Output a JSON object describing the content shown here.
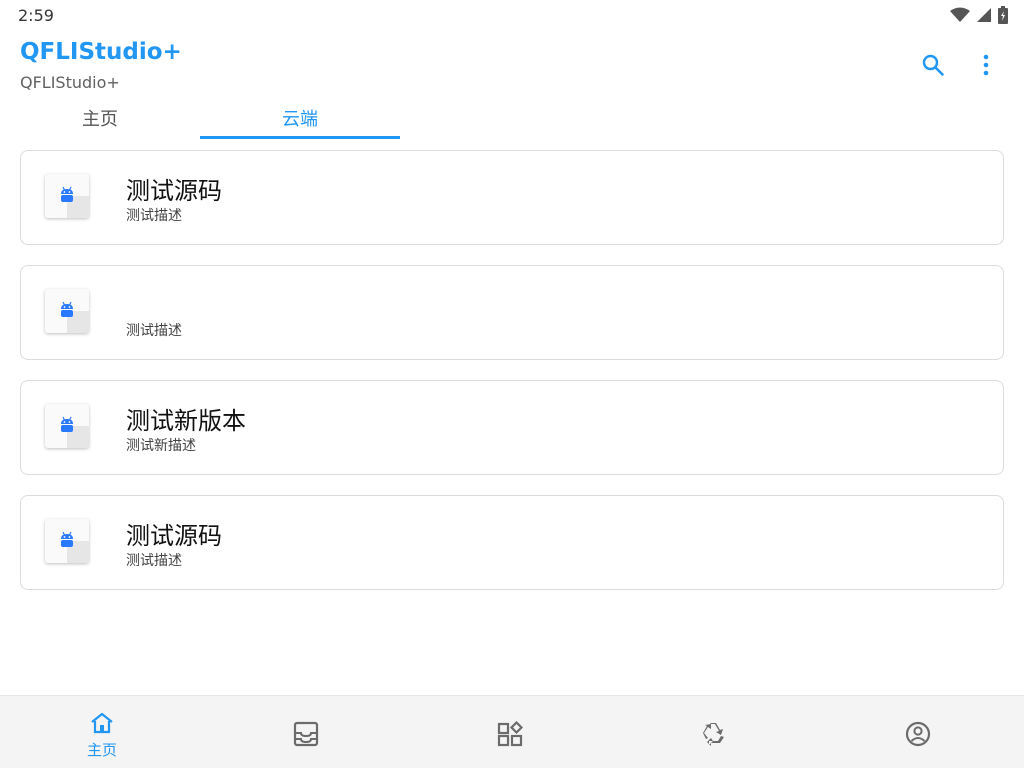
{
  "status_bar": {
    "time": "2:59",
    "icons": [
      "wifi-icon",
      "signal-icon",
      "battery-icon"
    ]
  },
  "app_bar": {
    "title": "QFLIStudio+",
    "subtitle": "QFLIStudio+",
    "actions": [
      "search-icon",
      "more-vert-icon"
    ],
    "accent_color": "#2196F3"
  },
  "tabs": [
    {
      "label": "主页",
      "selected": false
    },
    {
      "label": "云端",
      "selected": true
    }
  ],
  "cards": [
    {
      "title": "测试源码",
      "description": "测试描述",
      "icon": "android-icon"
    },
    {
      "title": "",
      "description": "测试描述",
      "icon": "android-icon"
    },
    {
      "title": "测试新版本",
      "description": "测试新描述",
      "icon": "android-icon"
    },
    {
      "title": "测试源码",
      "description": "测试描述",
      "icon": "android-icon"
    }
  ],
  "bottom_nav": [
    {
      "label": "主页",
      "icon": "home-icon",
      "selected": true
    },
    {
      "label": "",
      "icon": "inbox-icon",
      "selected": false
    },
    {
      "label": "",
      "icon": "widgets-icon",
      "selected": false
    },
    {
      "label": "",
      "icon": "recycle-icon",
      "selected": false
    },
    {
      "label": "",
      "icon": "account-circle-icon",
      "selected": false
    }
  ]
}
